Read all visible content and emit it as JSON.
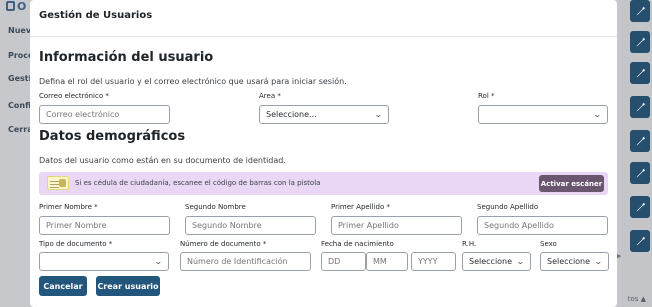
{
  "background": {
    "logo_text": "O",
    "nav": [
      "Nuev",
      "Proce",
      "Gestió",
      "Config",
      "Cerra"
    ],
    "footer_text": "tos ▲"
  },
  "modal": {
    "title": "Gestión de Usuarios",
    "user_info": {
      "title": "Información del usuario",
      "description": "Defina el rol del usuario y el correo electrónico que usará para iniciar sesión.",
      "email": {
        "label": "Correo electrónico *",
        "placeholder": "Correo electrónico",
        "value": ""
      },
      "area": {
        "label": "Area *",
        "selected": "Seleccione..."
      },
      "rol": {
        "label": "Rol *",
        "selected": ""
      }
    },
    "demographics": {
      "title": "Datos demográficos",
      "description": "Datos del usuario como están en su documento de identidad.",
      "scan_banner": {
        "text": "Si es cédula de ciudadanía, escanee el código de barras con la pistola",
        "button_label": "Activar escáner"
      },
      "primer_nombre": {
        "label": "Primer Nombre *",
        "placeholder": "Primer Nombre"
      },
      "segundo_nombre": {
        "label": "Segundo Nombre",
        "placeholder": "Segundo Nombre"
      },
      "primer_apellido": {
        "label": "Primer Apellido *",
        "placeholder": "Primer Apellido"
      },
      "segundo_apellido": {
        "label": "Segundo Apellido",
        "placeholder": "Segundo Apellido"
      },
      "tipo_documento": {
        "label": "Tipo de documento *",
        "selected": ""
      },
      "numero_documento": {
        "label": "Número de documento *",
        "placeholder": "Número de Identificación"
      },
      "fecha_nacimiento": {
        "label": "Fecha de nacimiento",
        "dd": "DD",
        "mm": "MM",
        "yyyy": "YYYY"
      },
      "rh": {
        "label": "R.H.",
        "selected": "Seleccione"
      },
      "sexo": {
        "label": "Sexo",
        "selected": "Seleccione"
      }
    },
    "actions": {
      "cancel_label": "Cancelar",
      "create_label": "Crear usuario"
    }
  }
}
